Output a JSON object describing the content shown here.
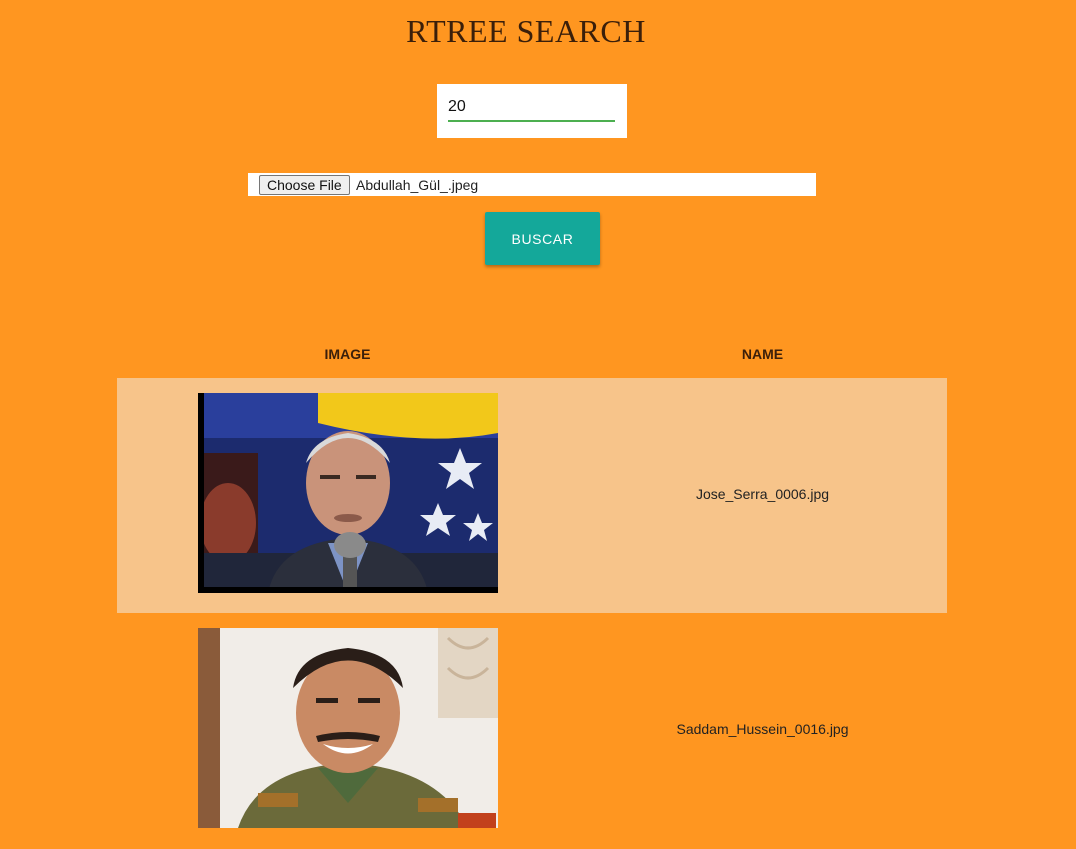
{
  "header": {
    "title": "RTREE SEARCH"
  },
  "form": {
    "k_value": "20",
    "file_button_label": "Choose File",
    "file_name": "Abdullah_Gül_.jpeg",
    "submit_label": "BUSCAR"
  },
  "results": {
    "columns": {
      "image": "IMAGE",
      "name": "NAME"
    },
    "rows": [
      {
        "name": "Jose_Serra_0006.jpg"
      },
      {
        "name": "Saddam_Hussein_0016.jpg"
      }
    ]
  },
  "colors": {
    "page_background": "#ff9620",
    "alt_row_background": "#f7c48a",
    "button_accent": "#14a89a",
    "input_underline": "#4caf50"
  }
}
